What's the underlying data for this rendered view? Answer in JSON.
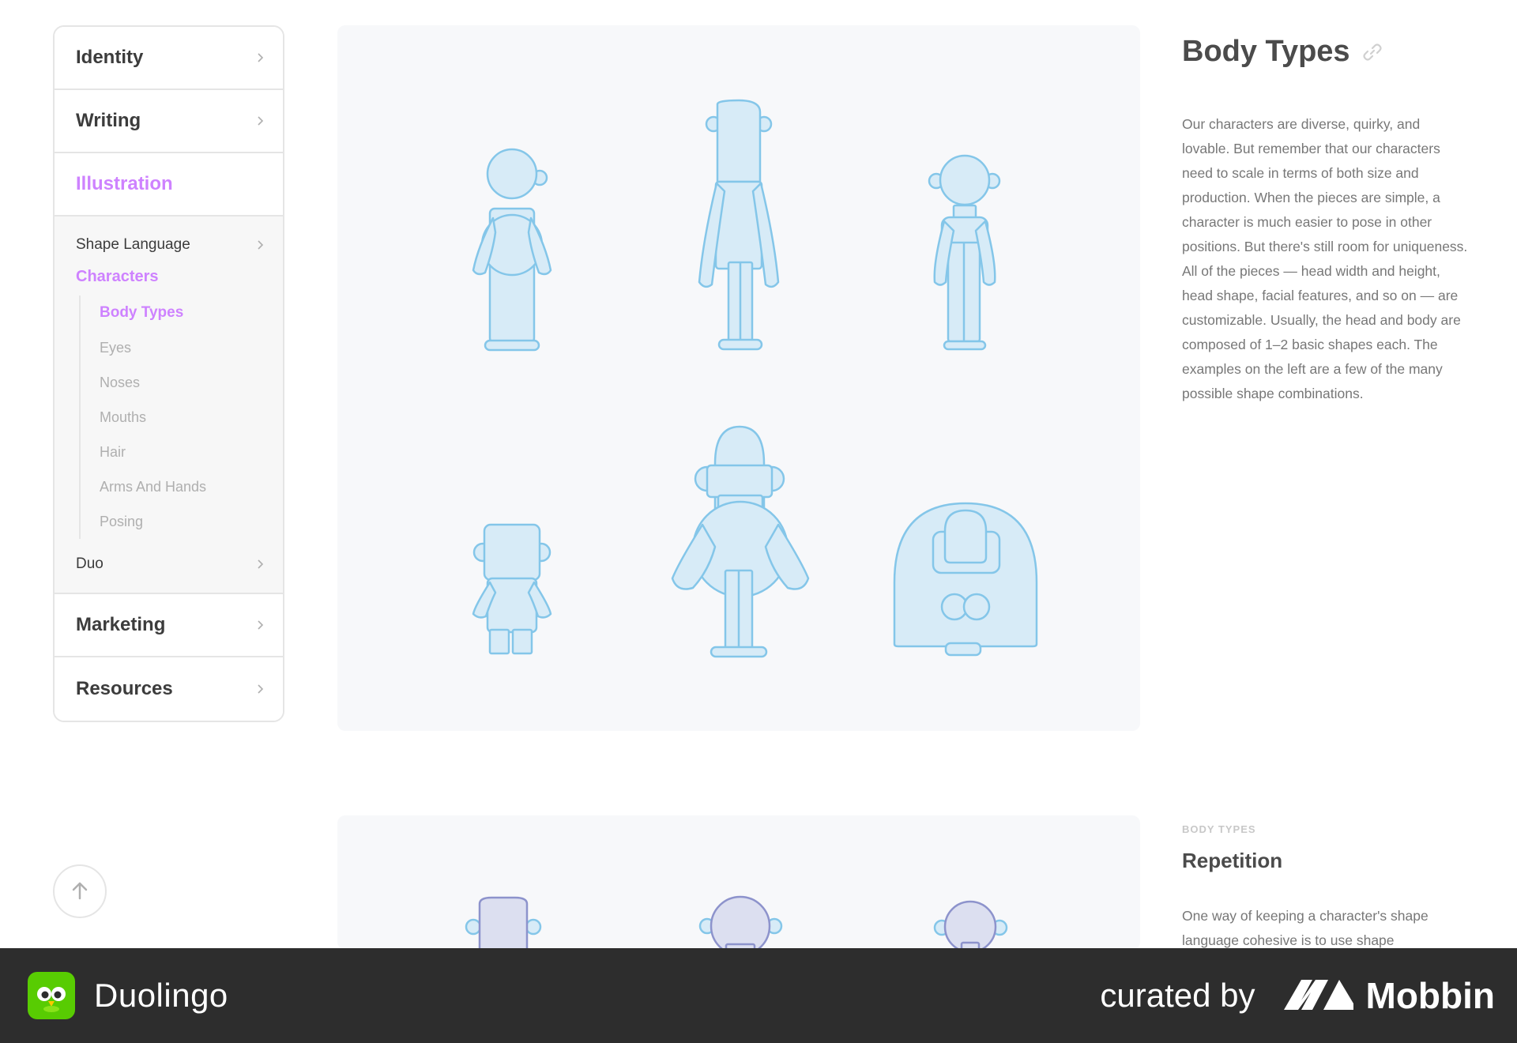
{
  "sidebar": {
    "top_items": [
      {
        "label": "Identity"
      },
      {
        "label": "Writing"
      },
      {
        "label": "Illustration"
      }
    ],
    "sub_items": {
      "shape_language": "Shape Language",
      "characters": "Characters",
      "duo": "Duo"
    },
    "character_items": [
      "Body Types",
      "Eyes",
      "Noses",
      "Mouths",
      "Hair",
      "Arms And Hands",
      "Posing"
    ],
    "bottom_items": [
      {
        "label": "Marketing"
      },
      {
        "label": "Resources"
      }
    ]
  },
  "section1": {
    "title": "Body Types",
    "description": "Our characters are diverse, quirky, and lovable. But remember that our characters need to scale in terms of both size and production. When the pieces are simple, a character is much easier to pose in other positions. But there's still room for uniqueness. All of the pieces — head width and height, head shape, facial features, and so on — are customizable. Usually, the head and body are composed of 1–2 basic shapes each. The examples on the left are a few of the many possible shape combinations."
  },
  "section2": {
    "eyebrow": "BODY TYPES",
    "title": "Repetition",
    "description": "One way of keeping a character's shape language cohesive is to use shape"
  },
  "footer": {
    "app_name": "Duolingo",
    "curated_by": "curated by",
    "curator": "Mobbin"
  },
  "colors": {
    "accent": "#ce82ff",
    "figure_fill": "#d7ebf7",
    "figure_stroke": "#84c6e9",
    "figure2_fill": "#dcdff0",
    "figure2_stroke": "#8d93cc"
  },
  "icons": {
    "chevron": "chevron-right-icon",
    "link": "link-icon",
    "back_to_top": "arrow-up-icon"
  }
}
